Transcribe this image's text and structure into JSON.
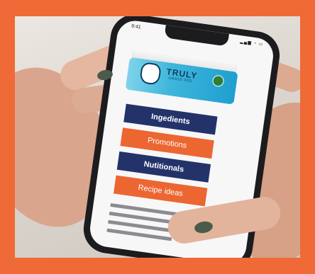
{
  "status_bar": {
    "time": "9:41",
    "icons": "▂▄▆ ◔ ▭"
  },
  "product": {
    "brand": "TRULY",
    "sub_brand": "GRASS FED",
    "image": "butter-tub"
  },
  "menu": {
    "items": [
      {
        "label": "Ingedients",
        "color": "#23336a"
      },
      {
        "label": "Promotions",
        "color": "#ec6631"
      },
      {
        "label": "Nutitionals",
        "color": "#23336a"
      },
      {
        "label": "Recipe ideas",
        "color": "#ec6631"
      }
    ]
  },
  "colors": {
    "frame": "#ef6a37",
    "navy": "#23336a",
    "orange": "#ec6631"
  }
}
